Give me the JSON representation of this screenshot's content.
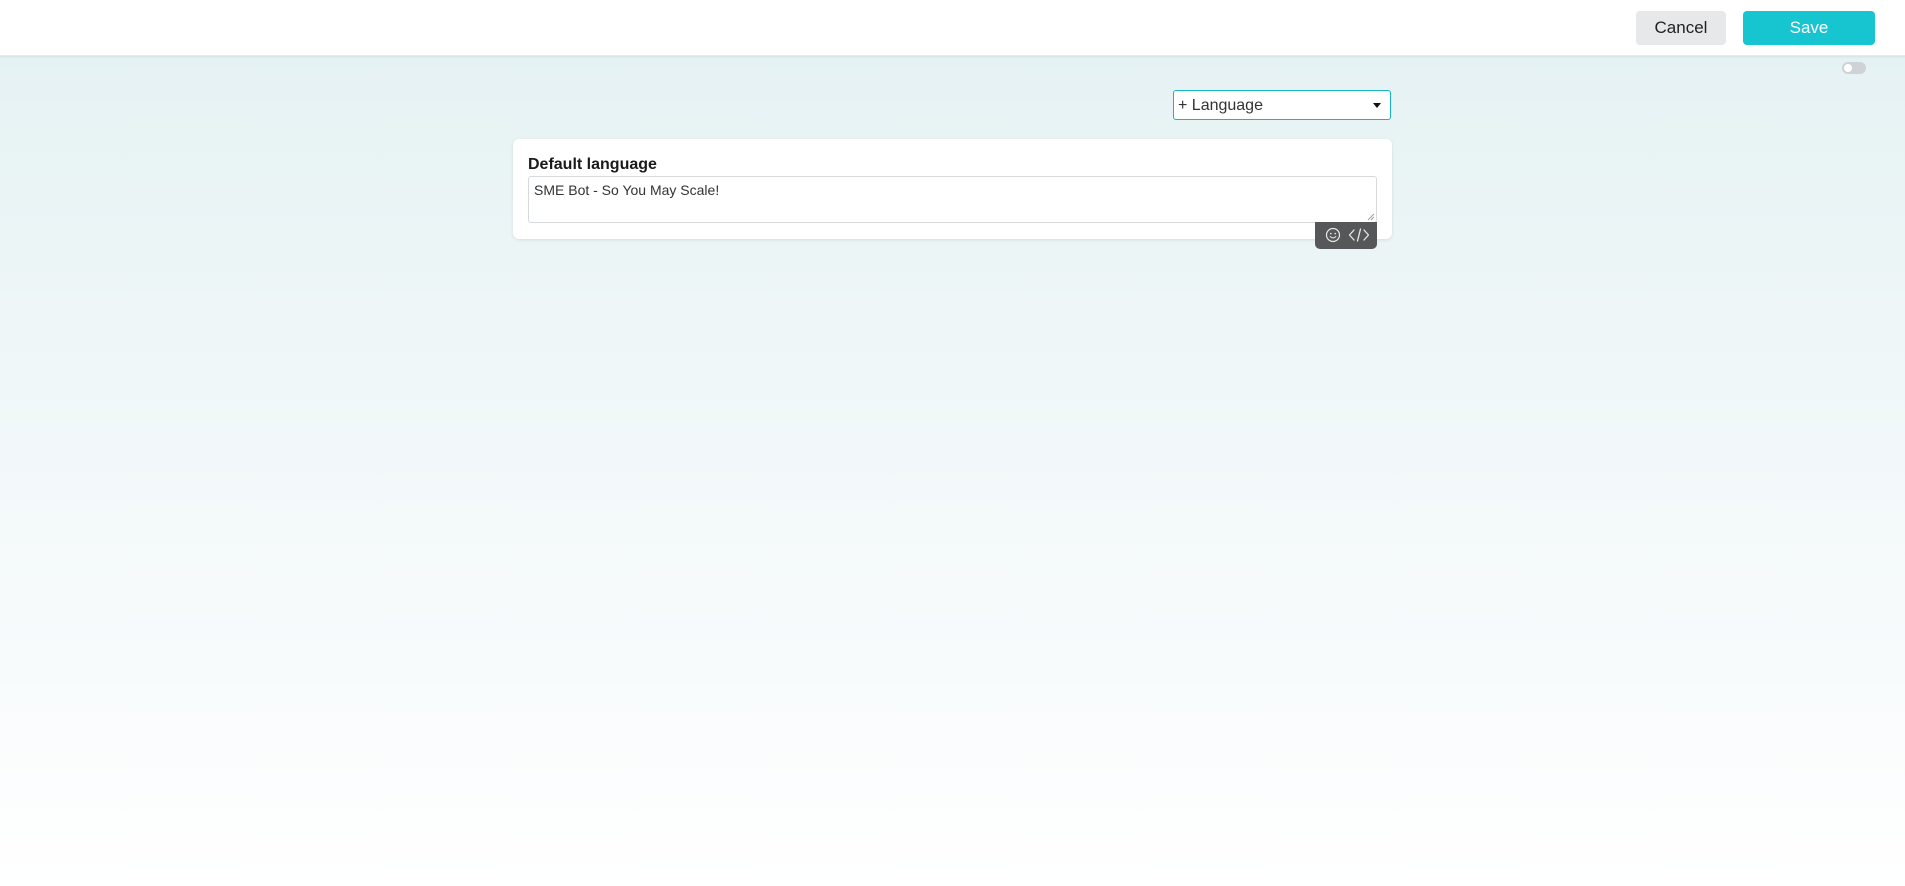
{
  "header": {
    "cancel_label": "Cancel",
    "save_label": "Save"
  },
  "toggle": {
    "state": "off"
  },
  "language_selector": {
    "label": "+ Language",
    "icon": "caret-down-icon"
  },
  "default_language": {
    "title": "Default language",
    "value": "SME Bot - So You May Scale!"
  },
  "editor_toolbar": {
    "icons": [
      "emoji-icon",
      "code-icon"
    ]
  },
  "colors": {
    "accent": "#17c5d1",
    "toolbar_bg": "#555759"
  }
}
